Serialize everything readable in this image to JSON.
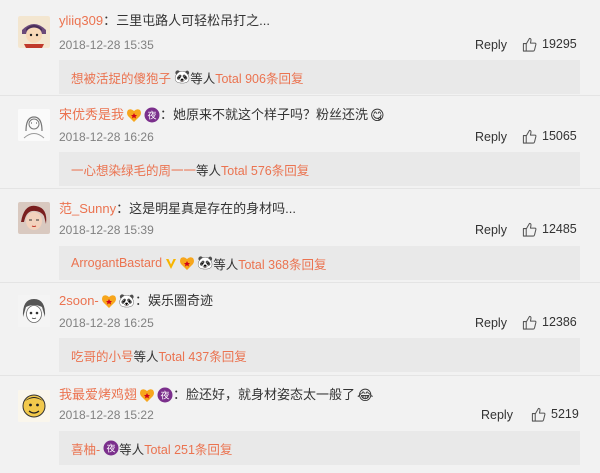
{
  "comments": [
    {
      "username": "yliiq309",
      "colon": "：",
      "text": "三里屯路人可轻松吊打之...",
      "time": "2018-12-28 15:35",
      "reply": "Reply",
      "likes": "19295",
      "sub": {
        "name": "想被活捉的傻狍子",
        "panda": "🐼",
        "suffix1": " 等人 ",
        "total": "Total 906条回复"
      }
    },
    {
      "username": "宋优秀是我",
      "colon": "：",
      "text": "她原来不就这个样子吗？粉丝还洗",
      "emoji": "😋",
      "time": "2018-12-28 16:26",
      "reply": "Reply",
      "likes": "15065",
      "sub": {
        "name": "一心想染绿毛的周一一",
        "suffix1": " 等人 ",
        "total": "Total 576条回复"
      }
    },
    {
      "username": "范_Sunny",
      "colon": "：",
      "text": "这是明星真是存在的身材吗...",
      "time": "2018-12-28 15:39",
      "reply": "Reply",
      "likes": "12485",
      "sub": {
        "name": "ArrogantBastard",
        "panda": "🐼",
        "suffix1": " 等人 ",
        "total": "Total 368条回复"
      }
    },
    {
      "username": "2soon-",
      "panda": "🐼",
      "colon": "：",
      "text": "娱乐圈奇迹",
      "time": "2018-12-28 16:25",
      "reply": "Reply",
      "likes": "12386",
      "sub": {
        "name": "吃哥的小号",
        "suffix1": " 等人 ",
        "total": "Total 437条回复"
      }
    },
    {
      "username": "我最爱烤鸡翅",
      "colon": "：",
      "text": "脸还好，就身材姿态太一般了",
      "emoji": "😂",
      "time": "2018-12-28 15:22",
      "reply": "Reply",
      "likes": "5219",
      "sub": {
        "name": "喜柚-",
        "suffix1": " 等人 ",
        "total": "Total 251条回复"
      }
    }
  ],
  "badge_char": "夜",
  "colors": {
    "accent": "#eb7350",
    "background": "#f2f2f2",
    "subbox": "#e9e9e9",
    "time": "#808080"
  }
}
